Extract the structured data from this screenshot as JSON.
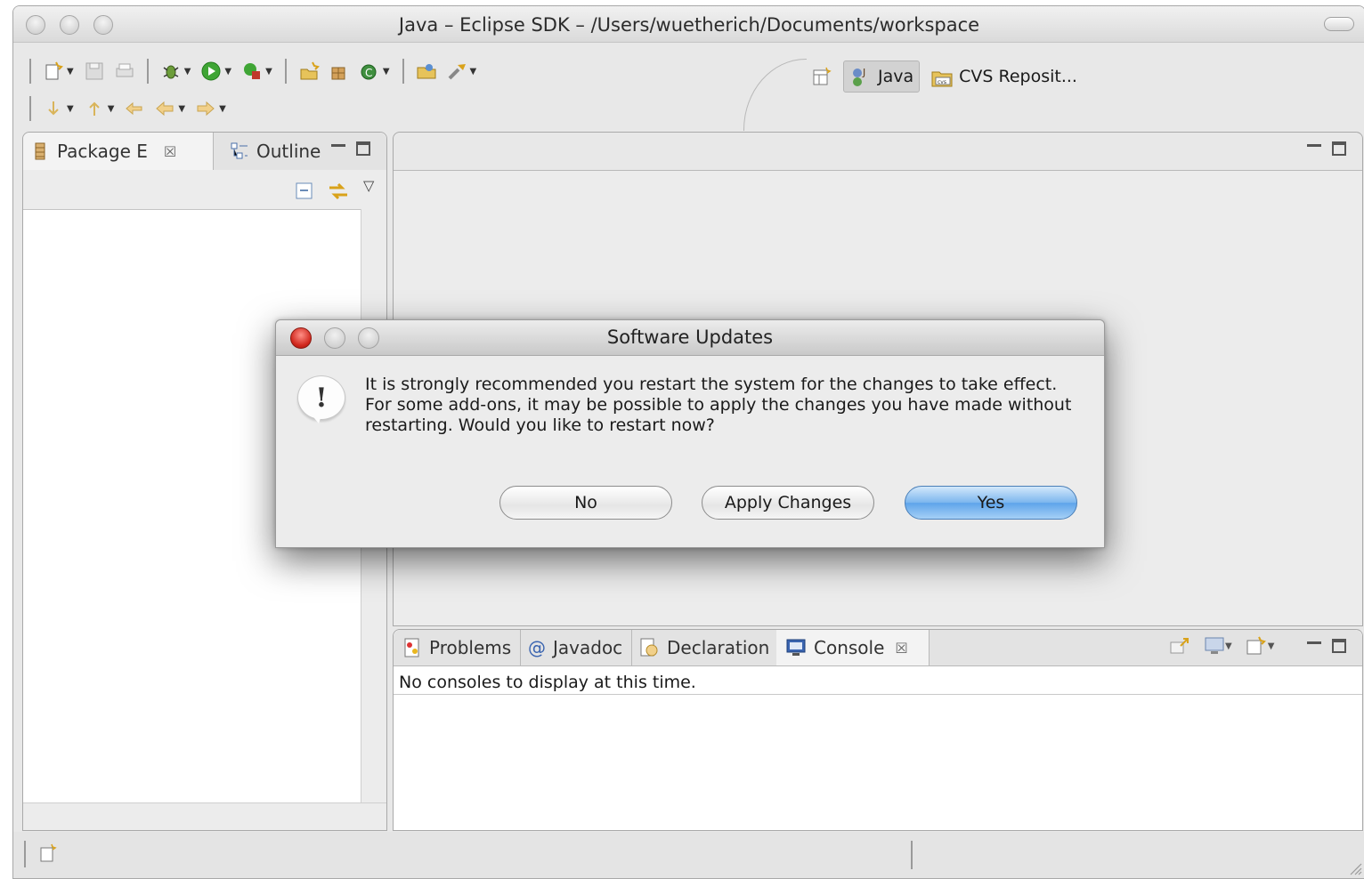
{
  "window": {
    "title": "Java – Eclipse SDK – /Users/wuetherich/Documents/workspace"
  },
  "perspectives": {
    "java_label": "Java",
    "cvs_label": "CVS Reposit..."
  },
  "left_pane": {
    "tabs": [
      {
        "label": "Package E",
        "close": "☒"
      },
      {
        "label": "Outline"
      }
    ]
  },
  "bottom_pane": {
    "tabs": [
      {
        "label": "Problems"
      },
      {
        "label": "Javadoc"
      },
      {
        "label": "Declaration"
      },
      {
        "label": "Console",
        "close": "☒"
      }
    ],
    "message": "No consoles to display at this time."
  },
  "dialog": {
    "title": "Software Updates",
    "icon_glyph": "!",
    "message": "It is strongly recommended you restart the system for the changes to take effect.\nFor some add-ons, it may be possible to apply the changes you have made without\nrestarting. Would you like to restart now?",
    "buttons": {
      "no": "No",
      "apply": "Apply Changes",
      "yes": "Yes"
    }
  },
  "colors": {
    "default_button": "#5ea4ea",
    "close_dot": "#d0271d"
  }
}
